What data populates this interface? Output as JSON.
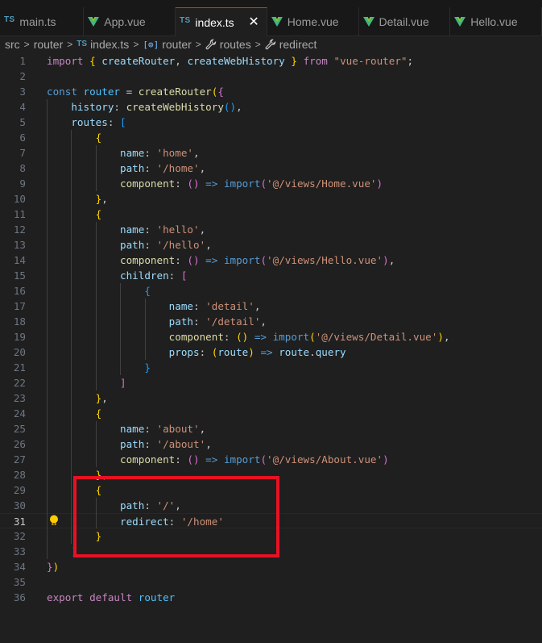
{
  "tabs": [
    {
      "label": "main.ts",
      "icon": "ts-icon",
      "active": false
    },
    {
      "label": "App.vue",
      "icon": "vue-icon",
      "active": false
    },
    {
      "label": "index.ts",
      "icon": "ts-icon",
      "active": true
    },
    {
      "label": "Home.vue",
      "icon": "vue-icon",
      "active": false
    },
    {
      "label": "Detail.vue",
      "icon": "vue-icon",
      "active": false
    },
    {
      "label": "Hello.vue",
      "icon": "vue-icon",
      "active": false
    }
  ],
  "tab_icon_text": {
    "ts": "TS",
    "close": "✕"
  },
  "breadcrumb": [
    {
      "label": "src",
      "icon": null
    },
    {
      "label": "router",
      "icon": null
    },
    {
      "label": "index.ts",
      "icon": "ts-icon"
    },
    {
      "label": "router",
      "icon": "variable-icon"
    },
    {
      "label": "routes",
      "icon": "wrench-icon"
    },
    {
      "label": "redirect",
      "icon": "wrench-icon"
    }
  ],
  "breadcrumb_icon_text": {
    "ts": "TS",
    "variable": "[⊛]",
    "wrench": "🔧",
    "sep": "›"
  },
  "editor": {
    "current_line": 31,
    "lines": [
      {
        "n": 1,
        "tokens": [
          [
            "kw",
            "import"
          ],
          [
            "punc",
            " "
          ],
          [
            "b1",
            "{"
          ],
          [
            "punc",
            " "
          ],
          [
            "prop",
            "createRouter"
          ],
          [
            "punc",
            ", "
          ],
          [
            "prop",
            "createWebHistory"
          ],
          [
            "punc",
            " "
          ],
          [
            "b1",
            "}"
          ],
          [
            "punc",
            " "
          ],
          [
            "kw",
            "from"
          ],
          [
            "punc",
            " "
          ],
          [
            "str",
            "\"vue-router\""
          ],
          [
            "punc",
            ";"
          ]
        ]
      },
      {
        "n": 2,
        "tokens": []
      },
      {
        "n": 3,
        "tokens": [
          [
            "kw2",
            "const"
          ],
          [
            "punc",
            " "
          ],
          [
            "var",
            "router"
          ],
          [
            "op",
            " = "
          ],
          [
            "fn",
            "createRouter"
          ],
          [
            "b1",
            "("
          ],
          [
            "b2",
            "{"
          ]
        ]
      },
      {
        "n": 4,
        "tokens": [
          [
            "punc",
            "    "
          ],
          [
            "prop",
            "history"
          ],
          [
            "punc",
            ": "
          ],
          [
            "fn",
            "createWebHistory"
          ],
          [
            "b3",
            "()"
          ],
          [
            "punc",
            ","
          ]
        ]
      },
      {
        "n": 5,
        "tokens": [
          [
            "punc",
            "    "
          ],
          [
            "prop",
            "routes"
          ],
          [
            "punc",
            ": "
          ],
          [
            "b3",
            "["
          ]
        ]
      },
      {
        "n": 6,
        "tokens": [
          [
            "punc",
            "        "
          ],
          [
            "b1",
            "{"
          ]
        ]
      },
      {
        "n": 7,
        "tokens": [
          [
            "punc",
            "            "
          ],
          [
            "prop",
            "name"
          ],
          [
            "punc",
            ": "
          ],
          [
            "str",
            "'home'"
          ],
          [
            "punc",
            ","
          ]
        ]
      },
      {
        "n": 8,
        "tokens": [
          [
            "punc",
            "            "
          ],
          [
            "prop",
            "path"
          ],
          [
            "punc",
            ": "
          ],
          [
            "str",
            "'/home'"
          ],
          [
            "punc",
            ","
          ]
        ]
      },
      {
        "n": 9,
        "tokens": [
          [
            "punc",
            "            "
          ],
          [
            "fn",
            "component"
          ],
          [
            "punc",
            ": "
          ],
          [
            "b2",
            "()"
          ],
          [
            "arrow",
            " => "
          ],
          [
            "imp",
            "import"
          ],
          [
            "b2",
            "("
          ],
          [
            "str",
            "'@/views/Home.vue'"
          ],
          [
            "b2",
            ")"
          ]
        ]
      },
      {
        "n": 10,
        "tokens": [
          [
            "punc",
            "        "
          ],
          [
            "b1",
            "}"
          ],
          [
            "punc",
            ","
          ]
        ]
      },
      {
        "n": 11,
        "tokens": [
          [
            "punc",
            "        "
          ],
          [
            "b1",
            "{"
          ]
        ]
      },
      {
        "n": 12,
        "tokens": [
          [
            "punc",
            "            "
          ],
          [
            "prop",
            "name"
          ],
          [
            "punc",
            ": "
          ],
          [
            "str",
            "'hello'"
          ],
          [
            "punc",
            ","
          ]
        ]
      },
      {
        "n": 13,
        "tokens": [
          [
            "punc",
            "            "
          ],
          [
            "prop",
            "path"
          ],
          [
            "punc",
            ": "
          ],
          [
            "str",
            "'/hello'"
          ],
          [
            "punc",
            ","
          ]
        ]
      },
      {
        "n": 14,
        "tokens": [
          [
            "punc",
            "            "
          ],
          [
            "fn",
            "component"
          ],
          [
            "punc",
            ": "
          ],
          [
            "b2",
            "()"
          ],
          [
            "arrow",
            " => "
          ],
          [
            "imp",
            "import"
          ],
          [
            "b2",
            "("
          ],
          [
            "str",
            "'@/views/Hello.vue'"
          ],
          [
            "b2",
            ")"
          ],
          [
            "punc",
            ","
          ]
        ]
      },
      {
        "n": 15,
        "tokens": [
          [
            "punc",
            "            "
          ],
          [
            "prop",
            "children"
          ],
          [
            "punc",
            ": "
          ],
          [
            "b2",
            "["
          ]
        ]
      },
      {
        "n": 16,
        "tokens": [
          [
            "punc",
            "                "
          ],
          [
            "b3",
            "{"
          ]
        ]
      },
      {
        "n": 17,
        "tokens": [
          [
            "punc",
            "                    "
          ],
          [
            "prop",
            "name"
          ],
          [
            "punc",
            ": "
          ],
          [
            "str",
            "'detail'"
          ],
          [
            "punc",
            ","
          ]
        ]
      },
      {
        "n": 18,
        "tokens": [
          [
            "punc",
            "                    "
          ],
          [
            "prop",
            "path"
          ],
          [
            "punc",
            ": "
          ],
          [
            "str",
            "'/detail'"
          ],
          [
            "punc",
            ","
          ]
        ]
      },
      {
        "n": 19,
        "tokens": [
          [
            "punc",
            "                    "
          ],
          [
            "fn",
            "component"
          ],
          [
            "punc",
            ": "
          ],
          [
            "b1",
            "()"
          ],
          [
            "arrow",
            " => "
          ],
          [
            "imp",
            "import"
          ],
          [
            "b1",
            "("
          ],
          [
            "str",
            "'@/views/Detail.vue'"
          ],
          [
            "b1",
            ")"
          ],
          [
            "punc",
            ","
          ]
        ]
      },
      {
        "n": 20,
        "tokens": [
          [
            "punc",
            "                    "
          ],
          [
            "prop",
            "props"
          ],
          [
            "punc",
            ": "
          ],
          [
            "b1",
            "("
          ],
          [
            "prop",
            "route"
          ],
          [
            "b1",
            ")"
          ],
          [
            "arrow",
            " => "
          ],
          [
            "prop",
            "route"
          ],
          [
            "punc",
            "."
          ],
          [
            "prop",
            "query"
          ]
        ]
      },
      {
        "n": 21,
        "tokens": [
          [
            "punc",
            "                "
          ],
          [
            "b3",
            "}"
          ]
        ]
      },
      {
        "n": 22,
        "tokens": [
          [
            "punc",
            "            "
          ],
          [
            "b2",
            "]"
          ]
        ]
      },
      {
        "n": 23,
        "tokens": [
          [
            "punc",
            "        "
          ],
          [
            "b1",
            "}"
          ],
          [
            "punc",
            ","
          ]
        ]
      },
      {
        "n": 24,
        "tokens": [
          [
            "punc",
            "        "
          ],
          [
            "b1",
            "{"
          ]
        ]
      },
      {
        "n": 25,
        "tokens": [
          [
            "punc",
            "            "
          ],
          [
            "prop",
            "name"
          ],
          [
            "punc",
            ": "
          ],
          [
            "str",
            "'about'"
          ],
          [
            "punc",
            ","
          ]
        ]
      },
      {
        "n": 26,
        "tokens": [
          [
            "punc",
            "            "
          ],
          [
            "prop",
            "path"
          ],
          [
            "punc",
            ": "
          ],
          [
            "str",
            "'/about'"
          ],
          [
            "punc",
            ","
          ]
        ]
      },
      {
        "n": 27,
        "tokens": [
          [
            "punc",
            "            "
          ],
          [
            "fn",
            "component"
          ],
          [
            "punc",
            ": "
          ],
          [
            "b2",
            "()"
          ],
          [
            "arrow",
            " => "
          ],
          [
            "imp",
            "import"
          ],
          [
            "b2",
            "("
          ],
          [
            "str",
            "'@/views/About.vue'"
          ],
          [
            "b2",
            ")"
          ]
        ]
      },
      {
        "n": 28,
        "tokens": [
          [
            "punc",
            "        "
          ],
          [
            "b1",
            "}"
          ],
          [
            "punc",
            ","
          ]
        ]
      },
      {
        "n": 29,
        "tokens": [
          [
            "punc",
            "        "
          ],
          [
            "b1",
            "{"
          ]
        ]
      },
      {
        "n": 30,
        "tokens": [
          [
            "punc",
            "            "
          ],
          [
            "prop",
            "path"
          ],
          [
            "punc",
            ": "
          ],
          [
            "str",
            "'/'"
          ],
          [
            "punc",
            ","
          ]
        ]
      },
      {
        "n": 31,
        "tokens": [
          [
            "punc",
            "            "
          ],
          [
            "prop",
            "redirect"
          ],
          [
            "punc",
            ": "
          ],
          [
            "str",
            "'/home'"
          ]
        ]
      },
      {
        "n": 32,
        "tokens": [
          [
            "punc",
            "        "
          ],
          [
            "b1",
            "}"
          ]
        ]
      },
      {
        "n": 33,
        "tokens": [
          [
            "punc",
            "    "
          ],
          [
            "b3",
            "]"
          ]
        ]
      },
      {
        "n": 34,
        "tokens": [
          [
            "b2",
            "}"
          ],
          [
            "b1",
            ")"
          ]
        ]
      },
      {
        "n": 35,
        "tokens": []
      },
      {
        "n": 36,
        "tokens": [
          [
            "kw",
            "export"
          ],
          [
            "punc",
            " "
          ],
          [
            "kw",
            "default"
          ],
          [
            "punc",
            " "
          ],
          [
            "var",
            "router"
          ]
        ]
      }
    ]
  },
  "annotation": {
    "label": "highlight-box",
    "color": "#e81123"
  },
  "lightbulb": {
    "line": 31,
    "color": "#ffcc00"
  }
}
